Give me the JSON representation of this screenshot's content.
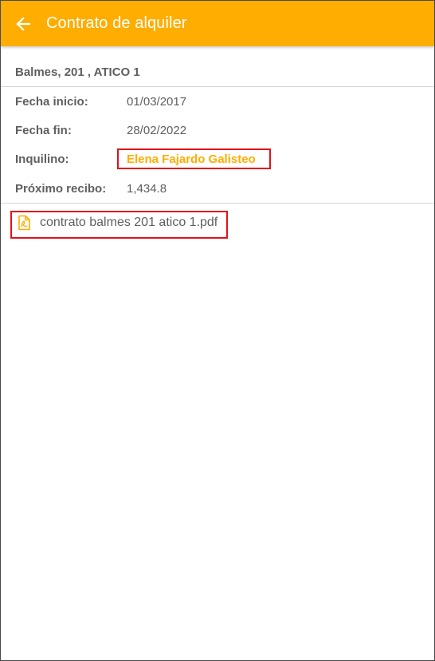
{
  "appbar": {
    "title": "Contrato de alquiler",
    "back_icon": "arrow-left-icon",
    "color": "#ffad00"
  },
  "property": {
    "address": "Balmes, 201 , ATICO 1"
  },
  "details": {
    "start_label": "Fecha inicio:",
    "start_value": "01/03/2017",
    "end_label": "Fecha fin:",
    "end_value": "28/02/2022",
    "tenant_label": "Inquilino:",
    "tenant_value": "Elena Fajardo Galisteo",
    "next_receipt_label": "Próximo recibo:",
    "next_receipt_value": "1,434.8"
  },
  "attachment": {
    "icon": "pdf-file-icon",
    "filename": "contrato balmes 201 atico 1.pdf"
  },
  "highlight_color": "#e0131a"
}
